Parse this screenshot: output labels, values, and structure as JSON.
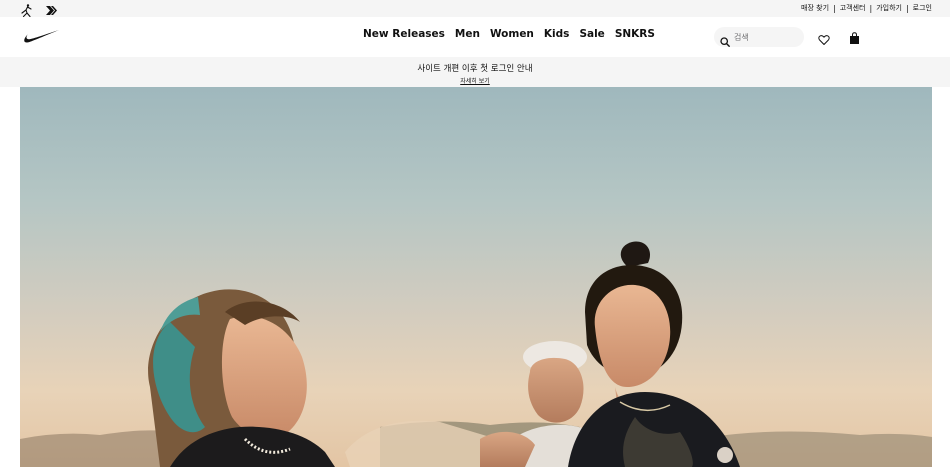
{
  "utility_bar": {
    "links": [
      "매장 찾기",
      "고객센터",
      "가입하기",
      "로그인"
    ],
    "brand_icons": [
      "jordan-icon",
      "converse-icon"
    ]
  },
  "header": {
    "logo": "nike-swoosh-icon",
    "nav": [
      "New Releases",
      "Men",
      "Women",
      "Kids",
      "Sale",
      "SNKRS"
    ],
    "search": {
      "placeholder": "검색",
      "value": ""
    },
    "icons": [
      "heart-icon",
      "bag-icon"
    ]
  },
  "announcement": {
    "title": "사이트 개편 이후 첫 로그인 안내",
    "link": "자세히 보기"
  },
  "colors": {
    "utility_bg": "#f5f5f5",
    "text": "#111111",
    "placeholder": "#707072"
  }
}
